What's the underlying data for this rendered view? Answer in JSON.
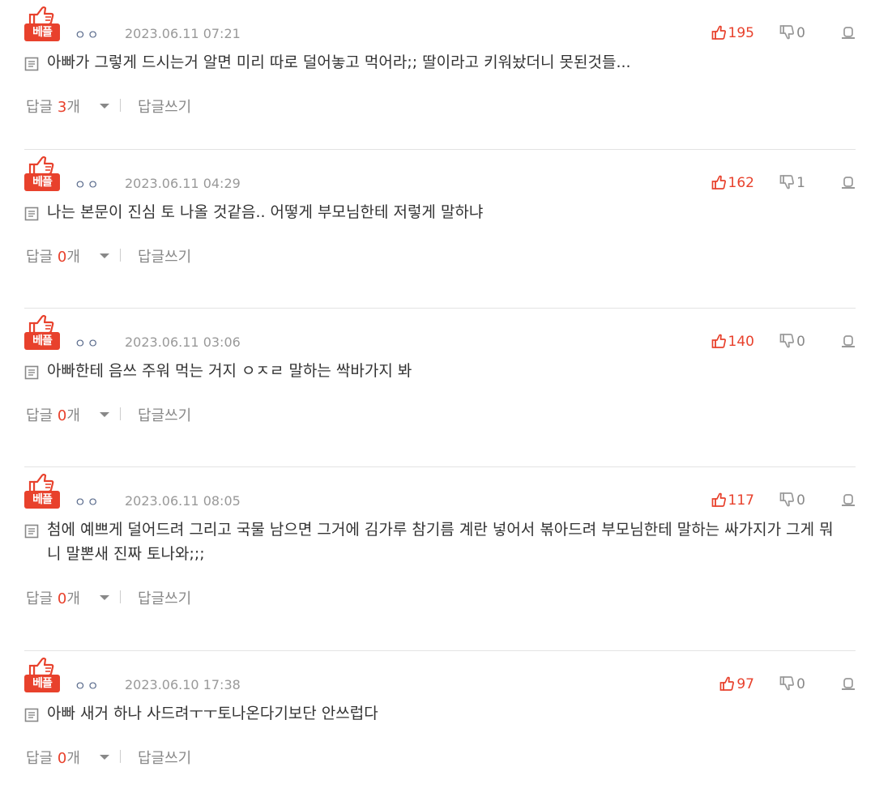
{
  "comments": [
    {
      "badge": "베플",
      "nickname": "ㅇㅇ",
      "date": "2023.06.11 07:21",
      "likes": "195",
      "dislikes": "0",
      "text": "아빠가 그렇게 드시는거 알면 미리 따로 덜어놓고 먹어라;; 딸이라고 키워놨더니 못된것들...",
      "reply_label": "답글",
      "reply_count": "3",
      "reply_unit": "개",
      "write_label": "답글쓰기"
    },
    {
      "badge": "베플",
      "nickname": "ㅇㅇ",
      "date": "2023.06.11 04:29",
      "likes": "162",
      "dislikes": "1",
      "text": "나는 본문이 진심 토 나올 것같음.. 어떻게 부모님한테 저렇게 말하냐",
      "reply_label": "답글",
      "reply_count": "0",
      "reply_unit": "개",
      "write_label": "답글쓰기"
    },
    {
      "badge": "베플",
      "nickname": "ㅇㅇ",
      "date": "2023.06.11 03:06",
      "likes": "140",
      "dislikes": "0",
      "text": "아빠한테 음쓰 주워 먹는 거지 ㅇㅈㄹ 말하는 싹바가지 봐",
      "reply_label": "답글",
      "reply_count": "0",
      "reply_unit": "개",
      "write_label": "답글쓰기"
    },
    {
      "badge": "베플",
      "nickname": "ㅇㅇ",
      "date": "2023.06.11 08:05",
      "likes": "117",
      "dislikes": "0",
      "text": "첨에 예쁘게 덜어드려 그리고 국물 남으면 그거에 김가루 참기름 계란 넣어서 볶아드려 부모님한테 말하는 싸가지가 그게 뭐니 말뽄새 진짜 토나와;;;",
      "reply_label": "답글",
      "reply_count": "0",
      "reply_unit": "개",
      "write_label": "답글쓰기"
    },
    {
      "badge": "베플",
      "nickname": "ㅇㅇ",
      "date": "2023.06.10 17:38",
      "likes": "97",
      "dislikes": "0",
      "text": "아빠 새거 하나 사드려ㅜㅜ토나온다기보단 안쓰럽다",
      "reply_label": "답글",
      "reply_count": "0",
      "reply_unit": "개",
      "write_label": "답글쓰기"
    }
  ],
  "icons": {
    "best": "thumbs-up-best-icon",
    "like": "thumbs-up-icon",
    "dislike": "thumbs-down-icon",
    "report": "report-icon",
    "memo": "memo-icon",
    "caret": "caret-down-icon"
  },
  "colors": {
    "accent": "#e8412c",
    "muted": "#888888",
    "date": "#999999",
    "nickname": "#5a6b8c",
    "divider": "#e3e3e3"
  }
}
